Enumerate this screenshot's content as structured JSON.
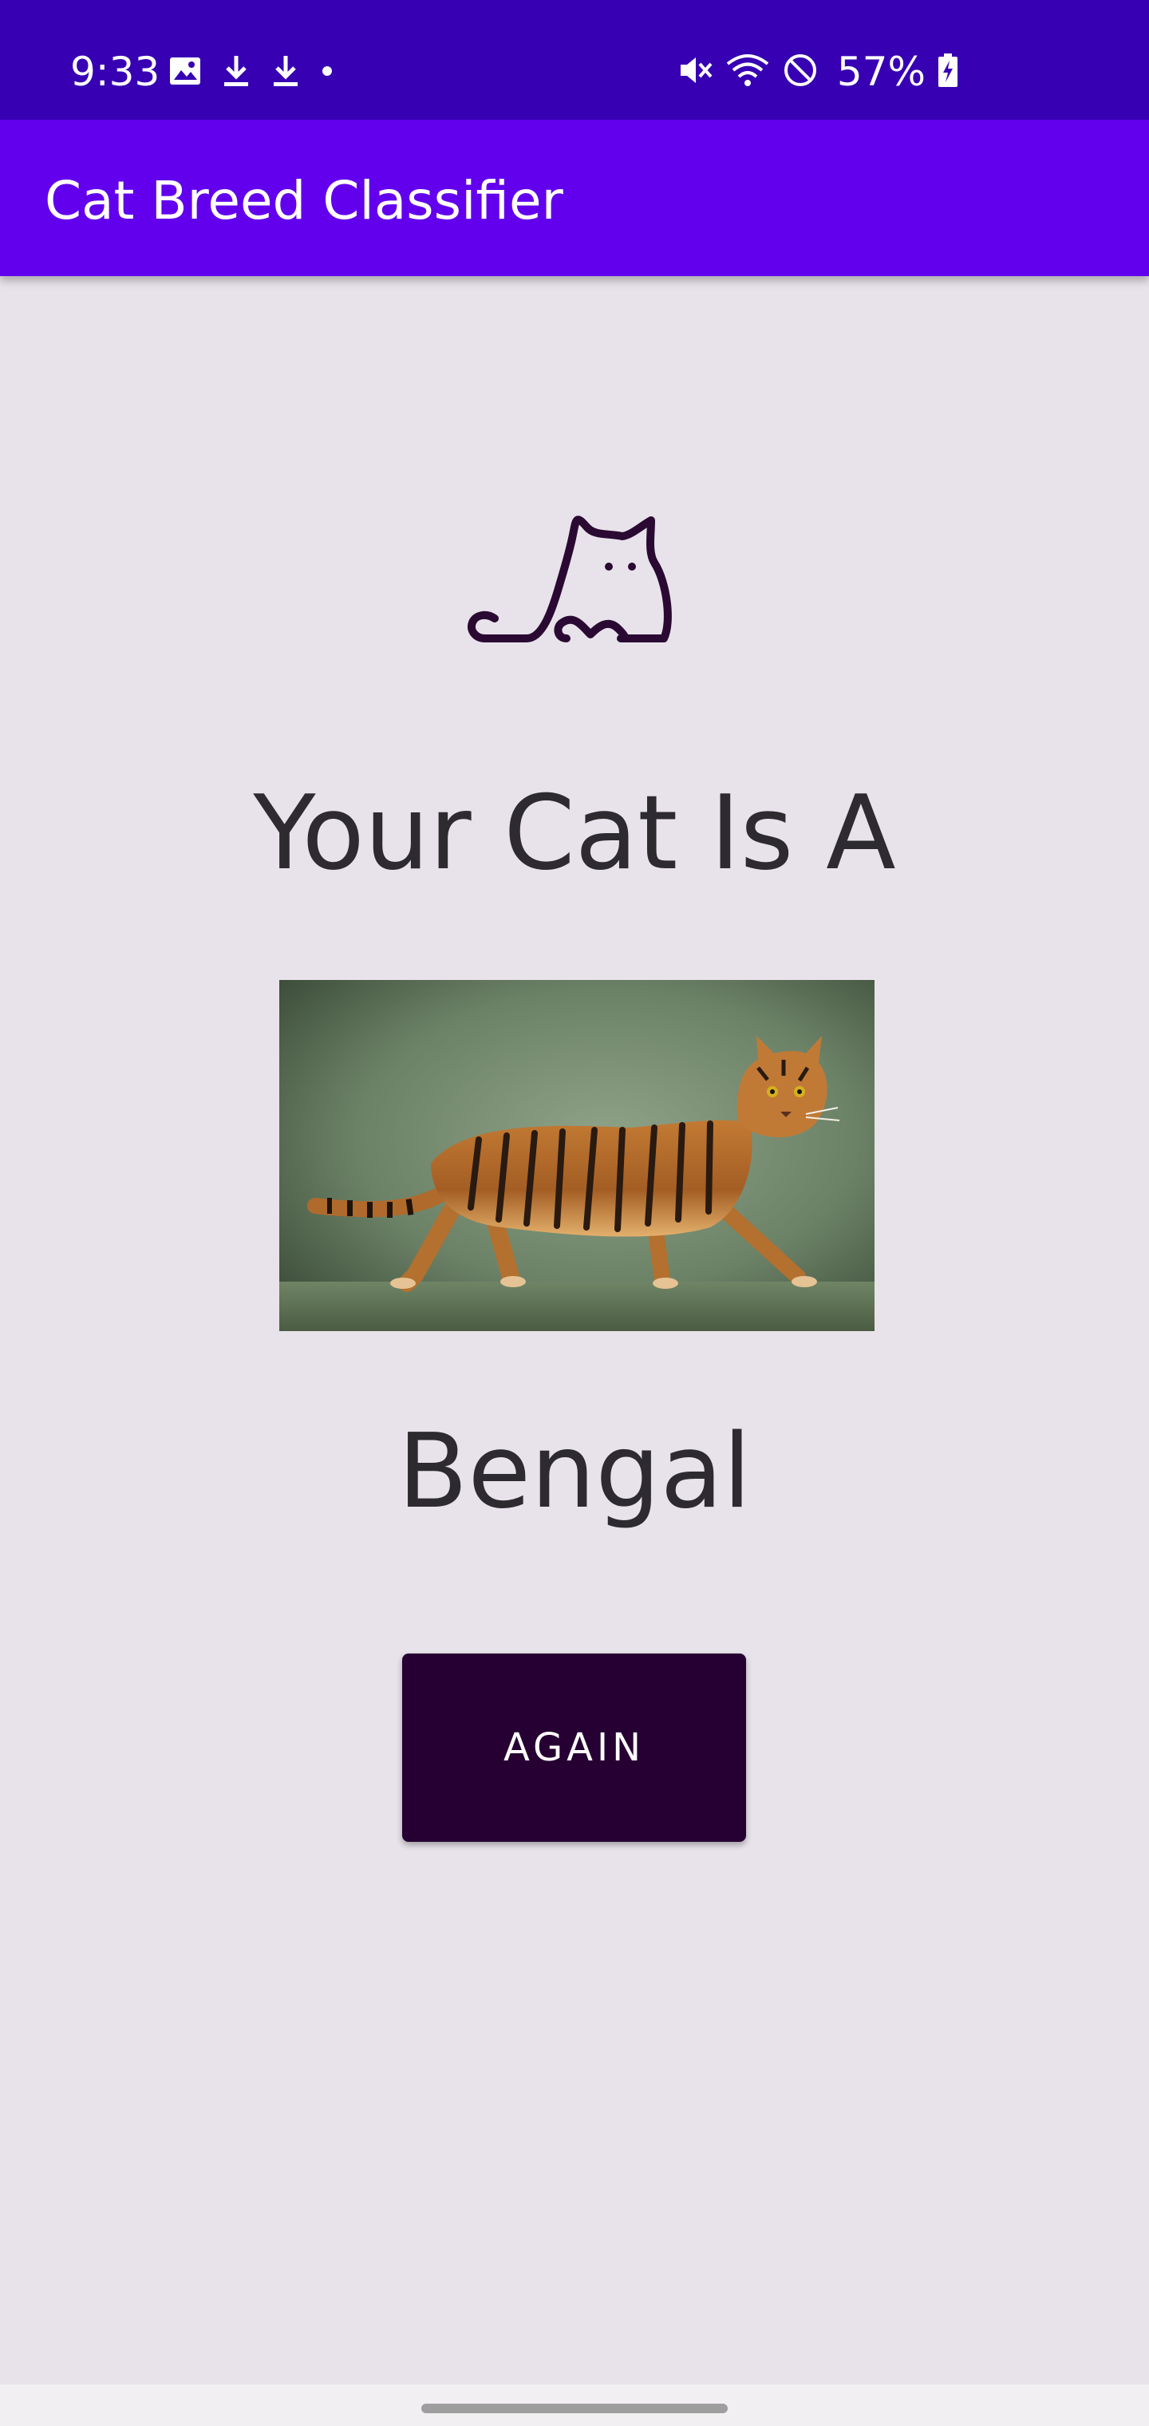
{
  "status_bar": {
    "time": "9:33",
    "battery": "57%",
    "left_icons": [
      "image-icon",
      "download-icon",
      "download-icon",
      "dot-icon"
    ],
    "right_icons": [
      "mute-icon",
      "wifi-icon",
      "do-not-disturb-icon",
      "battery-charging-icon"
    ],
    "background_color": "#3700b3"
  },
  "app_bar": {
    "title": "Cat Breed Classifier",
    "background_color": "#6200ee"
  },
  "main": {
    "logo_icon": "cat-outline-icon",
    "heading": "Your Cat Is A",
    "photo_icon": "bengal-cat-photo",
    "breed": "Bengal",
    "again_label": "AGAIN",
    "button_color": "#260033"
  },
  "nav": {
    "handle_icon": "gesture-handle"
  }
}
